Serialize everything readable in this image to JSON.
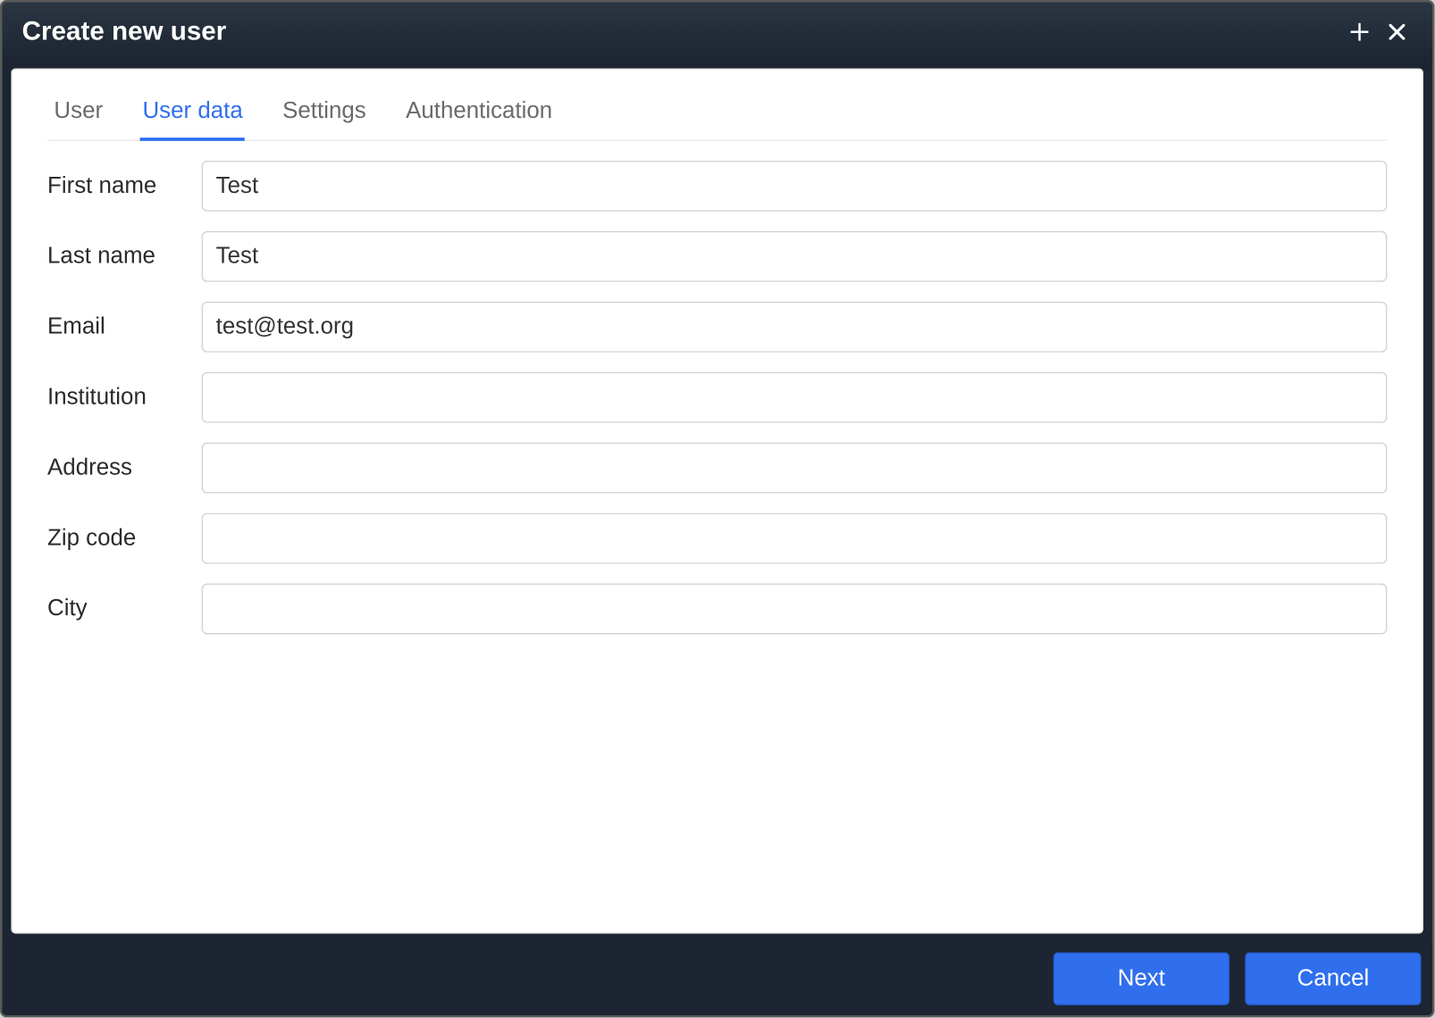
{
  "window": {
    "title": "Create new user"
  },
  "tabs": {
    "user": "User",
    "user_data": "User data",
    "settings": "Settings",
    "authentication": "Authentication",
    "active": "user_data"
  },
  "form": {
    "first_name": {
      "label": "First name",
      "value": "Test"
    },
    "last_name": {
      "label": "Last name",
      "value": "Test"
    },
    "email": {
      "label": "Email",
      "value": "test@test.org"
    },
    "institution": {
      "label": "Institution",
      "value": ""
    },
    "address": {
      "label": "Address",
      "value": ""
    },
    "zip_code": {
      "label": "Zip code",
      "value": ""
    },
    "city": {
      "label": "City",
      "value": ""
    }
  },
  "footer": {
    "next": "Next",
    "cancel": "Cancel"
  }
}
